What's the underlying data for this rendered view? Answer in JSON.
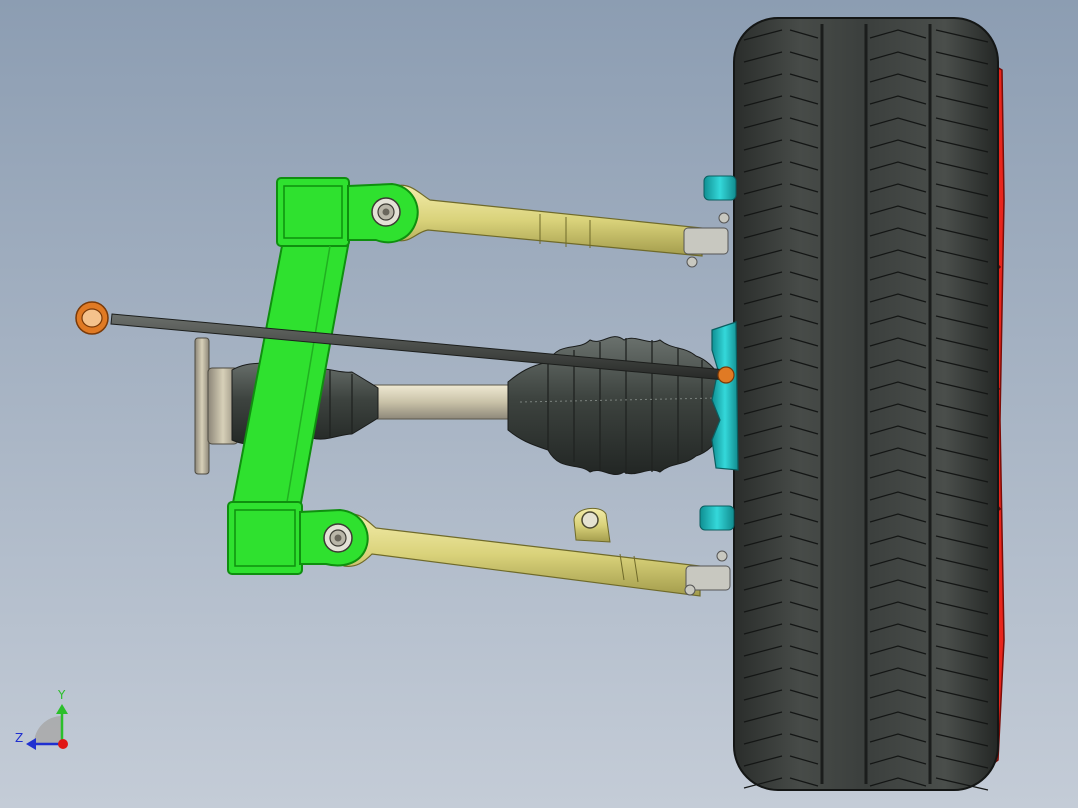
{
  "viewport": {
    "background_top": "#8c9db2",
    "background_bottom": "#c4ccd7"
  },
  "triad": {
    "y_label": "Y",
    "z_label": "Z",
    "y_color": "#2bbf2b",
    "z_color": "#1f2fd0",
    "x_color": "#e01515"
  },
  "colors": {
    "subframe": "#2fe12f",
    "subframe_edge": "#0f8f0f",
    "control_arm": "#d9d27a",
    "control_arm_edge": "#6f6a2a",
    "tire": "#3b3f3d",
    "tire_dark": "#1f2220",
    "axle": "#c9c2a8",
    "boot": "#3d433f",
    "knuckle": "#1fc1c4",
    "rotor": "#e8251c",
    "bushing": "#e07a24",
    "link": "#3a3d3a"
  },
  "components": [
    "subframe",
    "upper-control-arm",
    "lower-control-arm",
    "drive-shaft",
    "cv-boot-inner",
    "cv-boot-outer",
    "tie-rod",
    "wheel-tire",
    "brake-rotor",
    "knuckle"
  ]
}
